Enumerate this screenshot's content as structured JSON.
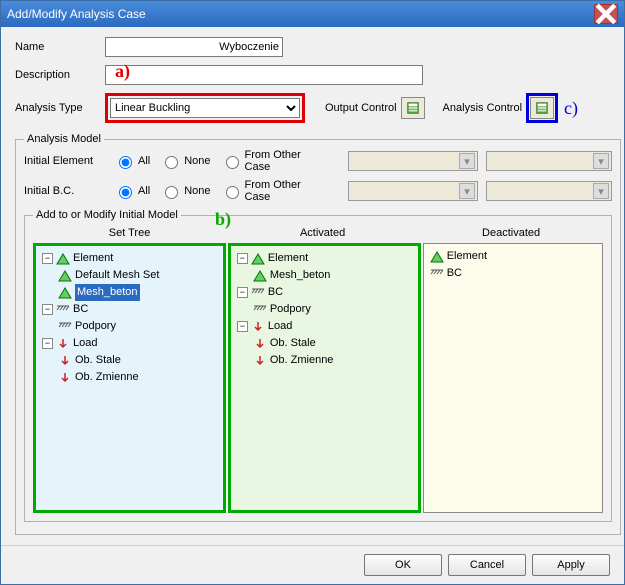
{
  "window": {
    "title": "Add/Modify Analysis Case"
  },
  "name": {
    "label": "Name",
    "value": "Wyboczenie"
  },
  "description": {
    "label": "Description",
    "value": ""
  },
  "analysis_type": {
    "label": "Analysis Type",
    "value": "Linear Buckling"
  },
  "output_control": "Output Control",
  "analysis_control": "Analysis Control",
  "analysis_model": {
    "legend": "Analysis Model",
    "initial_element": {
      "label": "Initial Element",
      "all": "All",
      "none": "None",
      "from_other": "From Other Case"
    },
    "initial_bc": {
      "label": "Initial B.C.",
      "all": "All",
      "none": "None",
      "from_other": "From Other Case"
    },
    "add_modify": {
      "legend": "Add to or Modify Initial Model",
      "headers": {
        "set_tree": "Set Tree",
        "activated": "Activated",
        "deactivated": "Deactivated"
      },
      "set_tree": {
        "element": "Element",
        "default_mesh": "Default Mesh Set",
        "mesh_beton": "Mesh_beton",
        "bc": "BC",
        "podpory": "Podpory",
        "load": "Load",
        "ob_stale": "Ob. Stale",
        "ob_zmienne": "Ob. Zmienne"
      },
      "activated": {
        "element": "Element",
        "mesh_beton": "Mesh_beton",
        "bc": "BC",
        "podpory": "Podpory",
        "load": "Load",
        "ob_stale": "Ob. Stale",
        "ob_zmienne": "Ob. Zmienne"
      },
      "deactivated": {
        "element": "Element",
        "bc": "BC"
      }
    }
  },
  "buttons": {
    "ok": "OK",
    "cancel": "Cancel",
    "apply": "Apply"
  },
  "annotations": {
    "a": "a)",
    "b": "b)",
    "c": "c)"
  },
  "colors": {
    "annotation_red": "#d00000",
    "annotation_green": "#00aa00",
    "annotation_blue": "#0000d0"
  }
}
